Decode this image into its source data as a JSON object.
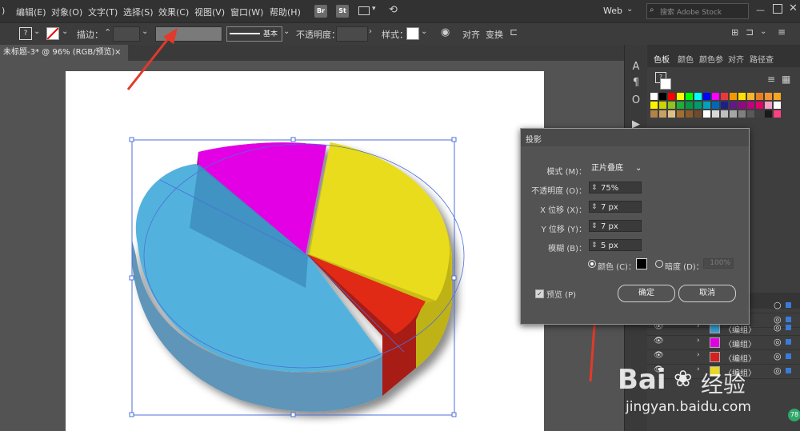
{
  "menubar": {
    "items": [
      ")",
      "编辑(E)",
      "对象(O)",
      "文字(T)",
      "选择(S)",
      "效果(C)",
      "视图(V)",
      "窗口(W)",
      "帮助(H)"
    ],
    "bridge_label": "Br",
    "stock_label": "St",
    "workspace": "Web",
    "search_placeholder": "搜索 Adobe Stock"
  },
  "controlbar": {
    "stroke_label": "描边：",
    "brush_label": "基本",
    "opacity_label": "不透明度：",
    "style_label": "样式：",
    "align_label": "对齐",
    "transform_label": "变换"
  },
  "document": {
    "tab_title": "未标题-3* @ 96% (RGB/预览)",
    "close": "×"
  },
  "color_panel": {
    "tabs": [
      "色板",
      "颜色",
      "颜色参",
      "对齐",
      "路径查"
    ],
    "swatch_colors": [
      [
        "#ffffff",
        "#000000",
        "#ff0000",
        "#ffff00",
        "#00ff00",
        "#00ffff",
        "#0000ff",
        "#ff00ff",
        "#e8383d",
        "#f39800",
        "#ffe100",
        "#f7b52c",
        "#e67e22",
        "#f19433",
        "#f6a623"
      ],
      [
        "#fff100",
        "#c9d500",
        "#8fc31f",
        "#22ac38",
        "#009944",
        "#009b6b",
        "#00a0c1",
        "#0068b7",
        "#1d2088",
        "#601986",
        "#920783",
        "#be0081",
        "#e5006a",
        "#f7a1c4",
        "#ffffff"
      ],
      [
        "#b28247",
        "#c9a063",
        "#dcc18a",
        "#a36f2e",
        "#8b5a2b",
        "#6d4c2e",
        "#ffffff",
        "#d9d9d9",
        "#bfbfbf",
        "#a6a6a6",
        "#808080",
        "#595959",
        "#404040",
        "#1a1a1a",
        "#ff4081"
      ]
    ]
  },
  "layers": [
    {
      "label": "〈编组〉",
      "color": "#3aa0d5"
    },
    {
      "label": "〈编组〉",
      "color": "#e000e0"
    },
    {
      "label": "〈编组〉",
      "color": "#d42020"
    },
    {
      "label": "〈编组〉",
      "color": "#e8d820"
    }
  ],
  "dialog": {
    "title": "投影",
    "mode_label": "模式 (M)：",
    "mode_value": "正片叠底",
    "opacity_label": "不透明度 (O)：",
    "opacity_value": "75%",
    "x_label": "X 位移 (X)：",
    "x_value": "7 px",
    "y_label": "Y 位移 (Y)：",
    "y_value": "7 px",
    "blur_label": "模糊 (B)：",
    "blur_value": "5 px",
    "color_label": "颜色 (C)：",
    "darkness_label": "暗度 (D)：",
    "darkness_value": "100%",
    "preview_label": "预览 (P)",
    "ok_label": "确定",
    "cancel_label": "取消"
  },
  "watermark": {
    "brand": "Bai",
    "brand_cn": "经验",
    "url": "jingyan.baidu.com",
    "badge": "78"
  }
}
